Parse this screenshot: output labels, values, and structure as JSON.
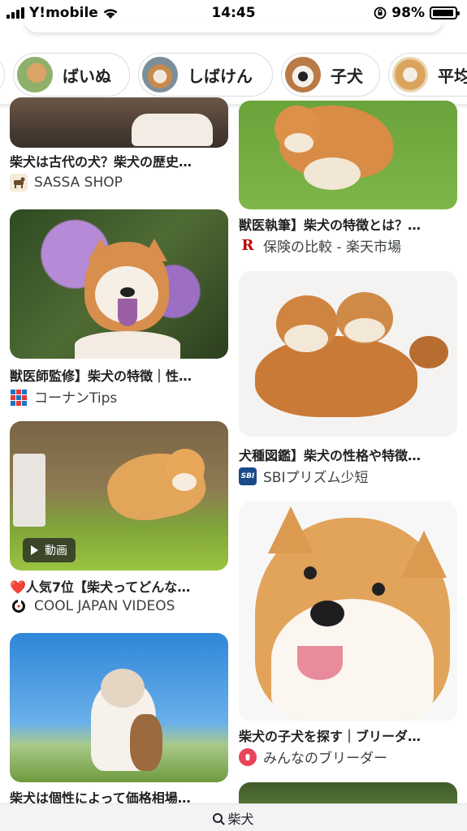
{
  "status_bar": {
    "carrier": "Y!mobile",
    "time": "14:45",
    "battery": "98%",
    "battery_level": 0.98
  },
  "chips": [
    {
      "label": "ばいぬ"
    },
    {
      "label": "しばけん"
    },
    {
      "label": "子犬"
    },
    {
      "label": "平均"
    }
  ],
  "results": {
    "left": [
      {
        "title": "柴犬は古代の犬？柴犬の歴史…",
        "source": "SASSA SHOP",
        "icon": "dog-favicon"
      },
      {
        "title": "獣医師監修】柴犬の特徴｜性…",
        "source": "コーナンTips",
        "icon": "grid-favicon"
      },
      {
        "title": "❤️人気7位【柴犬ってどんな…",
        "source": "COOL JAPAN VIDEOS",
        "icon": "circle-favicon",
        "badge": "動画"
      },
      {
        "title": "柴犬は個性によって価格相場…",
        "source": "",
        "icon": ""
      }
    ],
    "right": [
      {
        "title": "獣医執筆】柴犬の特徴とは？…",
        "source": "保険の比較 - 楽天市場",
        "icon": "rakuten-favicon"
      },
      {
        "title": "犬種図鑑】柴犬の性格や特徴…",
        "source": "SBIプリズム少短",
        "icon": "sbi-favicon",
        "icon_text": "SBI"
      },
      {
        "title": "柴犬の子犬を探す｜ブリーダ…",
        "source": "みんなのブリーダー",
        "icon": "minna-favicon"
      }
    ]
  },
  "bottom_bar": {
    "query": "柴犬"
  },
  "colors": {
    "rakuten": "#bf0000",
    "sbi": "#1a4a8a",
    "minna": "#e8445a"
  }
}
